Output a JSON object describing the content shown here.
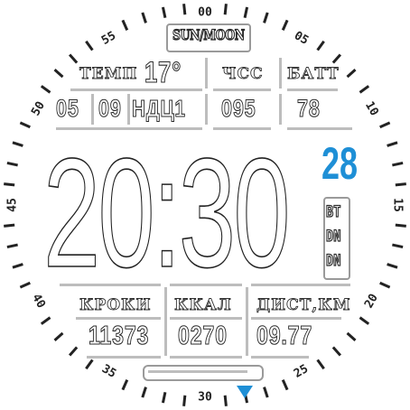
{
  "dial": {
    "labels": [
      "00",
      "05",
      "10",
      "15",
      "20",
      "25",
      "30",
      "35",
      "40",
      "45",
      "50",
      "55"
    ]
  },
  "top": {
    "sun_moon": "SUN/MOON"
  },
  "row1": {
    "temp_label": "ТЕМП",
    "temp_value": "17°",
    "hr_label": "ЧСС",
    "batt_label": "БАТТ"
  },
  "row2": {
    "day": "05",
    "month": "09",
    "weekday": "НДЦ1",
    "hr_value": "095",
    "batt_value": "78"
  },
  "time": {
    "text": "20:30",
    "seconds": "28"
  },
  "status": {
    "bt": "BT",
    "dnd": "DN",
    "alarm": "DN"
  },
  "bottom": {
    "steps_label": "КРОКИ",
    "steps_value": "11373",
    "kcal_label": "ККАЛ",
    "kcal_value": "0270",
    "dist_label": "ДИСТ,КМ",
    "dist_value": "09.77"
  },
  "colors": {
    "accent": "#1e8fd6",
    "bars": "#bdbdbd"
  }
}
